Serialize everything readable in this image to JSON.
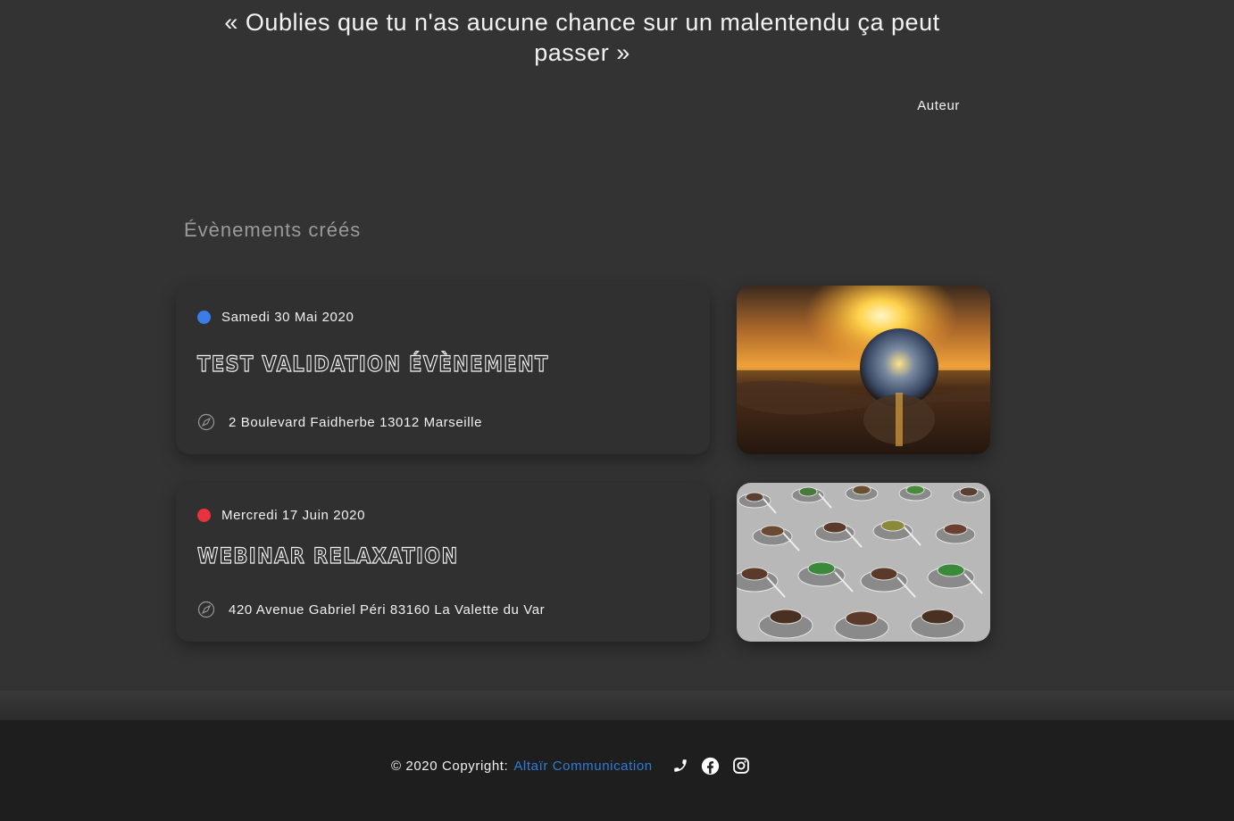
{
  "quote": {
    "text": "« Oublies que tu n'as aucune chance sur un malentendu ça peut passer »",
    "author": "Auteur"
  },
  "events_section": {
    "title": "Évènements créés"
  },
  "events": [
    {
      "date": "Samedi 30 Mai 2020",
      "status_color": "#3a7de8",
      "title": "Test validation évènement",
      "address": "2 Boulevard Faidherbe 13012 Marseille",
      "image_icon": "crystal-ball-sunset-image"
    },
    {
      "date": "Mercredi 17 Juin 2020",
      "status_color": "#e8323f",
      "title": "Webinar relaxation",
      "address": "420 Avenue Gabriel Péri 83160 La Valette du Var",
      "image_icon": "tea-cups-image"
    }
  ],
  "footer": {
    "copyright": "© 2020 Copyright:",
    "company": "Altaïr Communication",
    "link_color": "#2f7bd8",
    "social_icons": [
      "phone-icon",
      "facebook-icon",
      "instagram-icon"
    ]
  }
}
